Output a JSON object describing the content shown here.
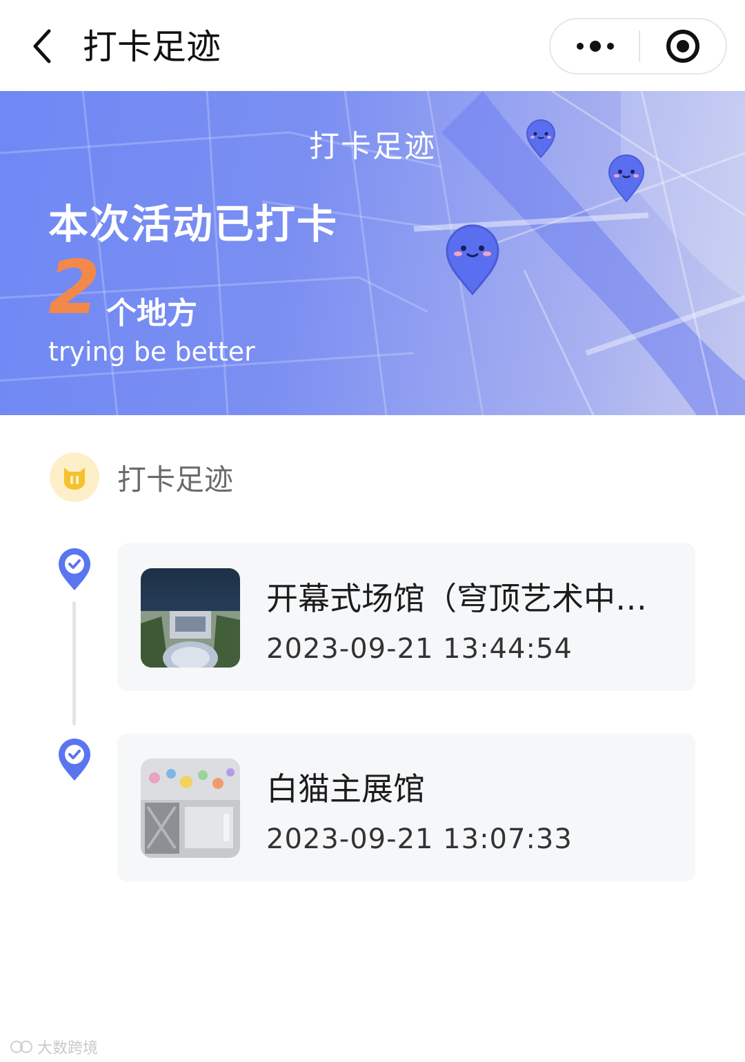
{
  "nav": {
    "title": "打卡足迹",
    "back_icon": "chevron-left-icon",
    "more_icon": "more-dots-icon",
    "target_icon": "record-target-icon"
  },
  "banner": {
    "title": "打卡足迹",
    "headline": "本次活动已打卡",
    "count": "2",
    "count_unit": "个地方",
    "slogan": "trying be better",
    "colors": {
      "gradient_start": "#6f88f4",
      "gradient_end": "#c4c9f0",
      "count": "#f2894a",
      "pin": "#5a6ef0"
    }
  },
  "section": {
    "title": "打卡足迹",
    "icon": "cat-badge-icon"
  },
  "checkins": [
    {
      "name": "开幕式场馆（穹顶艺术中心）",
      "time": "2023-09-21 13:44:54",
      "icon": "check-pin-icon"
    },
    {
      "name": "白猫主展馆",
      "time": "2023-09-21 13:07:33",
      "icon": "check-pin-icon"
    }
  ],
  "watermark": "大数跨境"
}
